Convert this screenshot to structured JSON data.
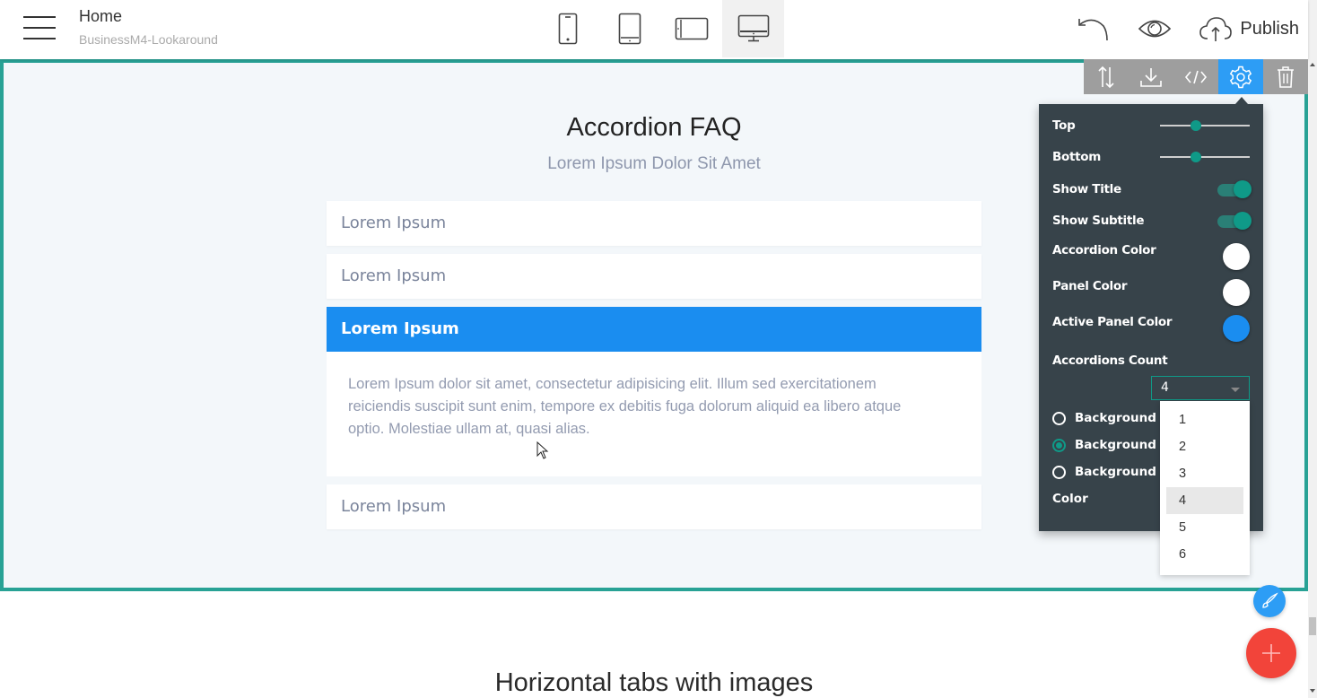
{
  "header": {
    "title": "Home",
    "subtitle": "BusinessM4-Lookaround",
    "devices": [
      {
        "name": "phone",
        "icon": "phone-icon",
        "active": false
      },
      {
        "name": "tablet",
        "icon": "tablet-icon",
        "active": false
      },
      {
        "name": "tablet-landscape",
        "icon": "tablet-landscape-icon",
        "active": false
      },
      {
        "name": "desktop",
        "icon": "desktop-icon",
        "active": true
      }
    ],
    "publish_label": "Publish"
  },
  "block_toolbar": {
    "items": [
      "move-icon",
      "download-icon",
      "code-icon",
      "gear-icon",
      "trash-icon"
    ],
    "active": "gear-icon"
  },
  "section": {
    "title": "Accordion FAQ",
    "subtitle": "Lorem Ipsum Dolor Sit Amet",
    "accordions": [
      {
        "label": "Lorem Ipsum",
        "active": false
      },
      {
        "label": "Lorem Ipsum",
        "active": false
      },
      {
        "label": "Lorem Ipsum",
        "active": true,
        "body": "Lorem Ipsum dolor sit amet, consectetur adipisicing elit. Illum sed exercitationem reiciendis suscipit sunt enim, tempore ex debitis fuga dolorum aliquid ea libero atque optio. Molestiae ullam at, quasi alias."
      },
      {
        "label": "Lorem Ipsum",
        "active": false
      }
    ]
  },
  "settings": {
    "top_label": "Top",
    "top_value": 0.4,
    "bottom_label": "Bottom",
    "bottom_value": 0.4,
    "show_title_label": "Show Title",
    "show_title": true,
    "show_subtitle_label": "Show Subtitle",
    "show_subtitle": true,
    "accordion_color_label": "Accordion Color",
    "accordion_color": "#ffffff",
    "panel_color_label": "Panel Color",
    "panel_color": "#ffffff",
    "active_panel_color_label": "Active Panel Color",
    "active_panel_color": "#1a8df0",
    "accordions_count_label": "Accordions Count",
    "accordions_count": "4",
    "count_options": [
      "1",
      "2",
      "3",
      "4",
      "5",
      "6"
    ],
    "background_options": [
      {
        "label": "Background Image",
        "checked": false
      },
      {
        "label": "Background Color",
        "checked": true
      },
      {
        "label": "Background Video",
        "checked": false
      }
    ],
    "color_label": "Color"
  },
  "lower_section": {
    "title": "Horizontal tabs with images"
  },
  "colors": {
    "accent": "#28a295",
    "toggle": "#0f9a88",
    "active_blue": "#2d9df5",
    "fab_add": "#f2443a"
  }
}
